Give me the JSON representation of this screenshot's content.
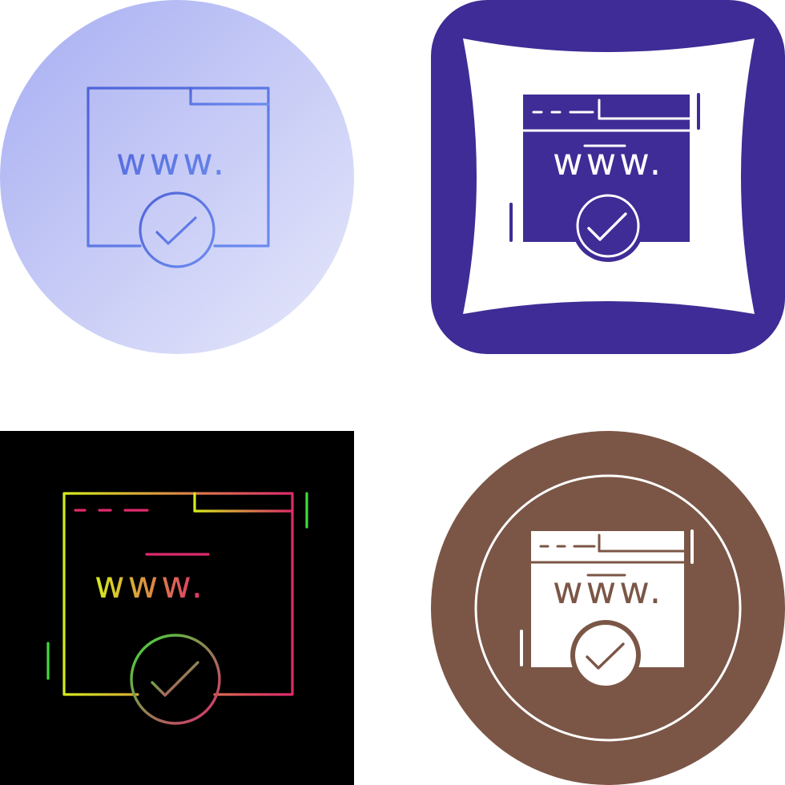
{
  "icon_set": [
    {
      "variant": "gradient-outline",
      "background_shape": "circle",
      "label": "www.",
      "colors": {
        "bg_from": "#a7aef2",
        "bg_to": "#e6e8fa",
        "stroke_from": "#4f63d8",
        "stroke_to": "#6c8cf0"
      },
      "icons": [
        "browser-window-icon",
        "checkmark-icon"
      ]
    },
    {
      "variant": "glyph-cushion",
      "background_shape": "rounded-square-cushion",
      "label": "www.",
      "colors": {
        "bg": "#3f2c96",
        "cushion": "#ffffff",
        "glyph": "#3f2c96",
        "glyph_text": "#ffffff"
      },
      "icons": [
        "browser-window-icon",
        "checkmark-icon"
      ]
    },
    {
      "variant": "neon-gradient-outline",
      "background_shape": "square",
      "label": "www.",
      "colors": {
        "bg": "#000000",
        "stroke_from": "#d7ec1d",
        "stroke_to": "#e02a6c",
        "green": "#3fdc3a"
      },
      "icons": [
        "browser-window-icon",
        "checkmark-icon"
      ]
    },
    {
      "variant": "glyph-circle",
      "background_shape": "circle",
      "label": "www.",
      "colors": {
        "bg": "#7b5646",
        "ring": "#ffffff",
        "glyph": "#ffffff",
        "glyph_text": "#7b5646"
      },
      "icons": [
        "browser-window-icon",
        "checkmark-icon"
      ]
    }
  ]
}
